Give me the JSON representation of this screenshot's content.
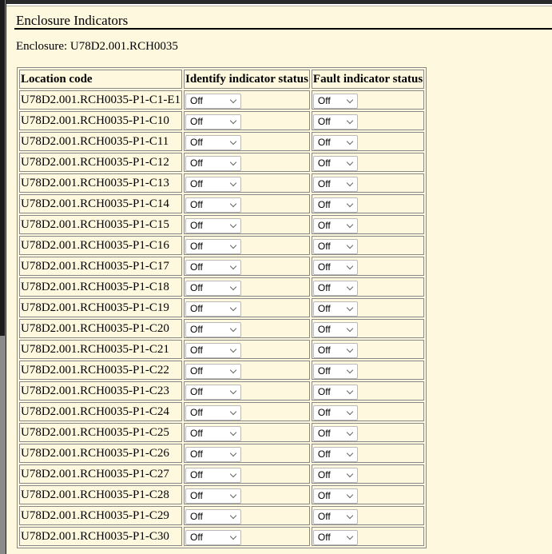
{
  "page": {
    "heading": "Enclosure Indicators",
    "enclosure_line": "Enclosure: U78D2.001.RCH0035"
  },
  "table": {
    "headers": [
      "Location code",
      "Identify indicator status",
      "Fault indicator status"
    ],
    "rows": [
      {
        "location": "U78D2.001.RCH0035-P1-C1-E1",
        "identify": "Off",
        "fault": "Off"
      },
      {
        "location": "U78D2.001.RCH0035-P1-C10",
        "identify": "Off",
        "fault": "Off"
      },
      {
        "location": "U78D2.001.RCH0035-P1-C11",
        "identify": "Off",
        "fault": "Off"
      },
      {
        "location": "U78D2.001.RCH0035-P1-C12",
        "identify": "Off",
        "fault": "Off"
      },
      {
        "location": "U78D2.001.RCH0035-P1-C13",
        "identify": "Off",
        "fault": "Off"
      },
      {
        "location": "U78D2.001.RCH0035-P1-C14",
        "identify": "Off",
        "fault": "Off"
      },
      {
        "location": "U78D2.001.RCH0035-P1-C15",
        "identify": "Off",
        "fault": "Off"
      },
      {
        "location": "U78D2.001.RCH0035-P1-C16",
        "identify": "Off",
        "fault": "Off"
      },
      {
        "location": "U78D2.001.RCH0035-P1-C17",
        "identify": "Off",
        "fault": "Off"
      },
      {
        "location": "U78D2.001.RCH0035-P1-C18",
        "identify": "Off",
        "fault": "Off"
      },
      {
        "location": "U78D2.001.RCH0035-P1-C19",
        "identify": "Off",
        "fault": "Off"
      },
      {
        "location": "U78D2.001.RCH0035-P1-C20",
        "identify": "Off",
        "fault": "Off"
      },
      {
        "location": "U78D2.001.RCH0035-P1-C21",
        "identify": "Off",
        "fault": "Off"
      },
      {
        "location": "U78D2.001.RCH0035-P1-C22",
        "identify": "Off",
        "fault": "Off"
      },
      {
        "location": "U78D2.001.RCH0035-P1-C23",
        "identify": "Off",
        "fault": "Off"
      },
      {
        "location": "U78D2.001.RCH0035-P1-C24",
        "identify": "Off",
        "fault": "Off"
      },
      {
        "location": "U78D2.001.RCH0035-P1-C25",
        "identify": "Off",
        "fault": "Off"
      },
      {
        "location": "U78D2.001.RCH0035-P1-C26",
        "identify": "Off",
        "fault": "Off"
      },
      {
        "location": "U78D2.001.RCH0035-P1-C27",
        "identify": "Off",
        "fault": "Off"
      },
      {
        "location": "U78D2.001.RCH0035-P1-C28",
        "identify": "Off",
        "fault": "Off"
      },
      {
        "location": "U78D2.001.RCH0035-P1-C29",
        "identify": "Off",
        "fault": "Off"
      },
      {
        "location": "U78D2.001.RCH0035-P1-C30",
        "identify": "Off",
        "fault": "Off"
      }
    ]
  }
}
